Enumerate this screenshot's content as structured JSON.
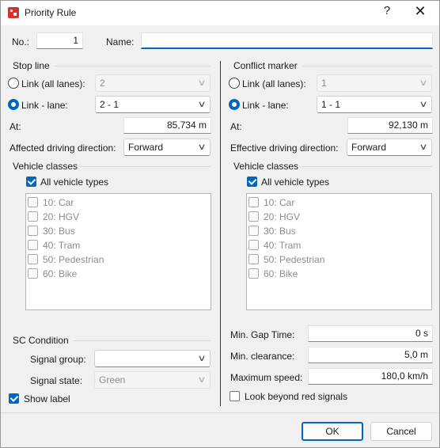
{
  "window": {
    "title": "Priority Rule",
    "help_label": "?",
    "close_label": "✕"
  },
  "header": {
    "no_label": "No.:",
    "no_value": "1",
    "name_label": "Name:",
    "name_value": ""
  },
  "stop_line": {
    "title": "Stop line",
    "link_all_lanes_label": "Link (all lanes):",
    "link_all_lanes_value": "2",
    "link_lane_label": "Link - lane:",
    "link_lane_value": "2 - 1",
    "at_label": "At:",
    "at_value": "85,734 m",
    "direction_label": "Affected driving direction:",
    "direction_value": "Forward",
    "vehicle_classes_title": "Vehicle classes",
    "all_vehicle_types_label": "All vehicle types",
    "vehicle_types": [
      "10: Car",
      "20: HGV",
      "30: Bus",
      "40: Tram",
      "50: Pedestrian",
      "60: Bike"
    ]
  },
  "sc_condition": {
    "title": "SC Condition",
    "signal_group_label": "Signal group:",
    "signal_group_value": "",
    "signal_state_label": "Signal state:",
    "signal_state_value": "Green",
    "show_label_label": "Show label"
  },
  "conflict_marker": {
    "title": "Conflict marker",
    "link_all_lanes_label": "Link (all lanes):",
    "link_all_lanes_value": "1",
    "link_lane_label": "Link - lane:",
    "link_lane_value": "1 - 1",
    "at_label": "At:",
    "at_value": "92,130 m",
    "direction_label": "Effective driving direction:",
    "direction_value": "Forward",
    "vehicle_classes_title": "Vehicle classes",
    "all_vehicle_types_label": "All vehicle types",
    "vehicle_types": [
      "10: Car",
      "20: HGV",
      "30: Bus",
      "40: Tram",
      "50: Pedestrian",
      "60: Bike"
    ],
    "min_gap_time_label": "Min. Gap Time:",
    "min_gap_time_value": "0 s",
    "min_clearance_label": "Min. clearance:",
    "min_clearance_value": "5,0 m",
    "max_speed_label": "Maximum speed:",
    "max_speed_value": "180,0 km/h",
    "look_beyond_label": "Look beyond red signals"
  },
  "buttons": {
    "ok_label": "OK",
    "cancel_label": "Cancel"
  },
  "colors": {
    "accent": "#0067c0",
    "icon_red": "#d4322c"
  }
}
